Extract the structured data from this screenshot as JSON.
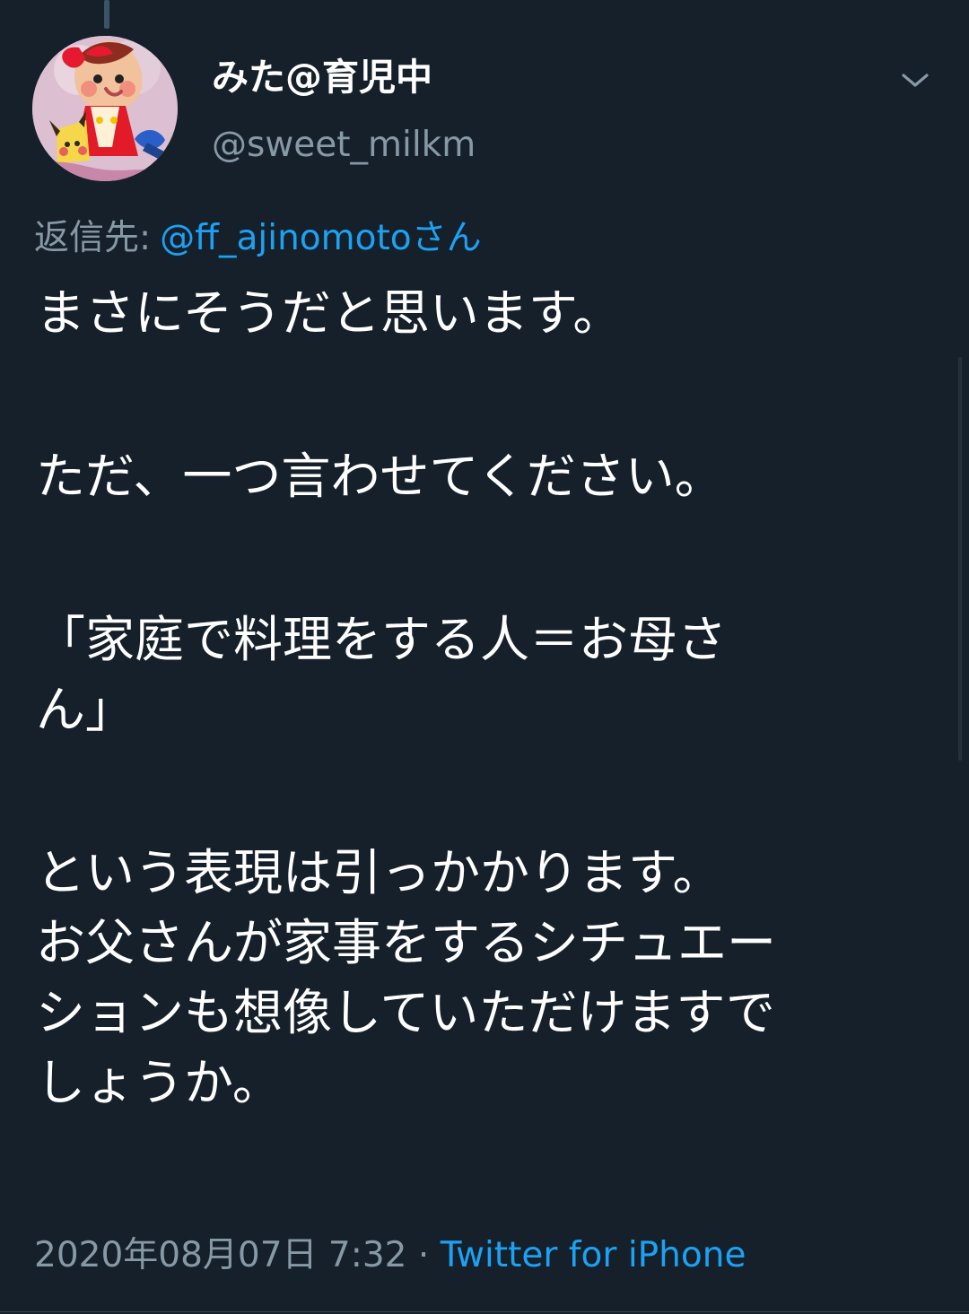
{
  "tweet": {
    "display_name": "みた@育児中",
    "handle": "@sweet_milkm",
    "reply_prefix": "返信先:",
    "reply_target": "@ff_ajinomotoさん",
    "paragraphs": [
      "まさにそうだと思います。",
      "ただ、一つ言わせてください。",
      "「家庭で料理をする人＝お母さ",
      "ん」",
      "という表現は引っかかります。",
      "お父さんが家事をするシチュエー",
      "ションも想像していただけますで",
      "しょうか。"
    ],
    "timestamp": "2020年08月07日 7:32",
    "separator": "·",
    "source": "Twitter for iPhone"
  },
  "colors": {
    "background": "#15202b",
    "text": "#ffffff",
    "secondary_text": "#8899a6",
    "link": "#1da1f2",
    "divider": "#38444d"
  },
  "icons": {
    "more": "chevron-down-icon",
    "avatar": "avatar-image"
  }
}
